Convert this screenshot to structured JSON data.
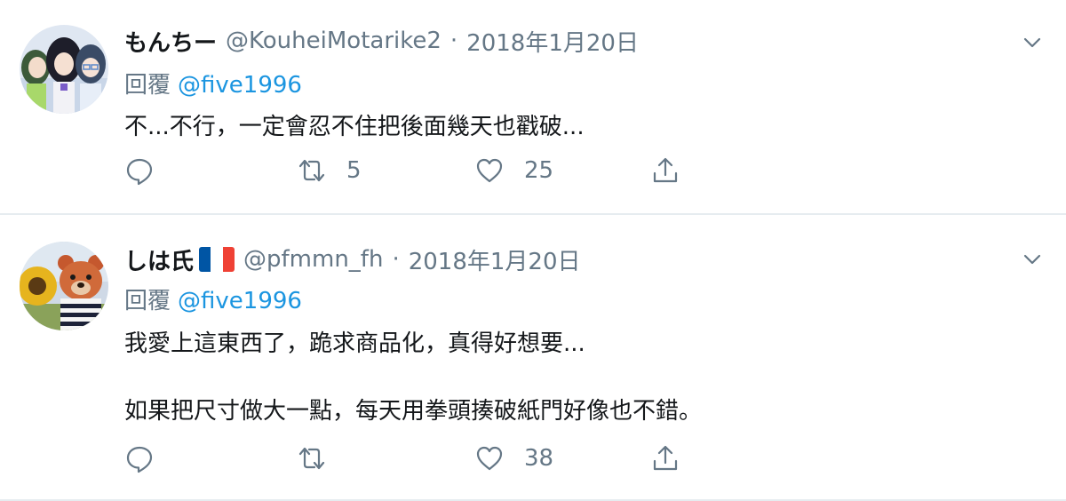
{
  "tweets": [
    {
      "display_name": "もんちー",
      "handle": "@KouheiMotarike2",
      "separator": "·",
      "time": "2018年1月20日",
      "reply_prefix": "回覆",
      "reply_to": "@five1996",
      "text": [
        "不...不行，一定會忍不住把後面幾天也戳破..."
      ],
      "retweets": "5",
      "likes": "25",
      "avatar_icon": "anime-avatar-icon"
    },
    {
      "display_name": "しは氏",
      "flag": {
        "name": "france-flag-icon",
        "colors": [
          "#0055a4",
          "#ffffff",
          "#ef4135"
        ]
      },
      "handle": "@pfmmn_fh",
      "separator": "·",
      "time": "2018年1月20日",
      "reply_prefix": "回覆",
      "reply_to": "@five1996",
      "text": [
        "我愛上這東西了，跪求商品化，真得好想要...",
        "如果把尺寸做大一點，每天用拳頭揍破紙門好像也不錯。"
      ],
      "retweets": "",
      "likes": "38",
      "avatar_icon": "teddy-bear-avatar-icon"
    }
  ],
  "icons": {
    "reply": "reply-icon",
    "retweet": "retweet-icon",
    "like": "heart-icon",
    "share": "share-icon",
    "menu": "chevron-down-icon"
  },
  "colors": {
    "name": "#14171a",
    "muted": "#657786",
    "link": "#1b95e0",
    "divider": "#e6ecf0"
  }
}
